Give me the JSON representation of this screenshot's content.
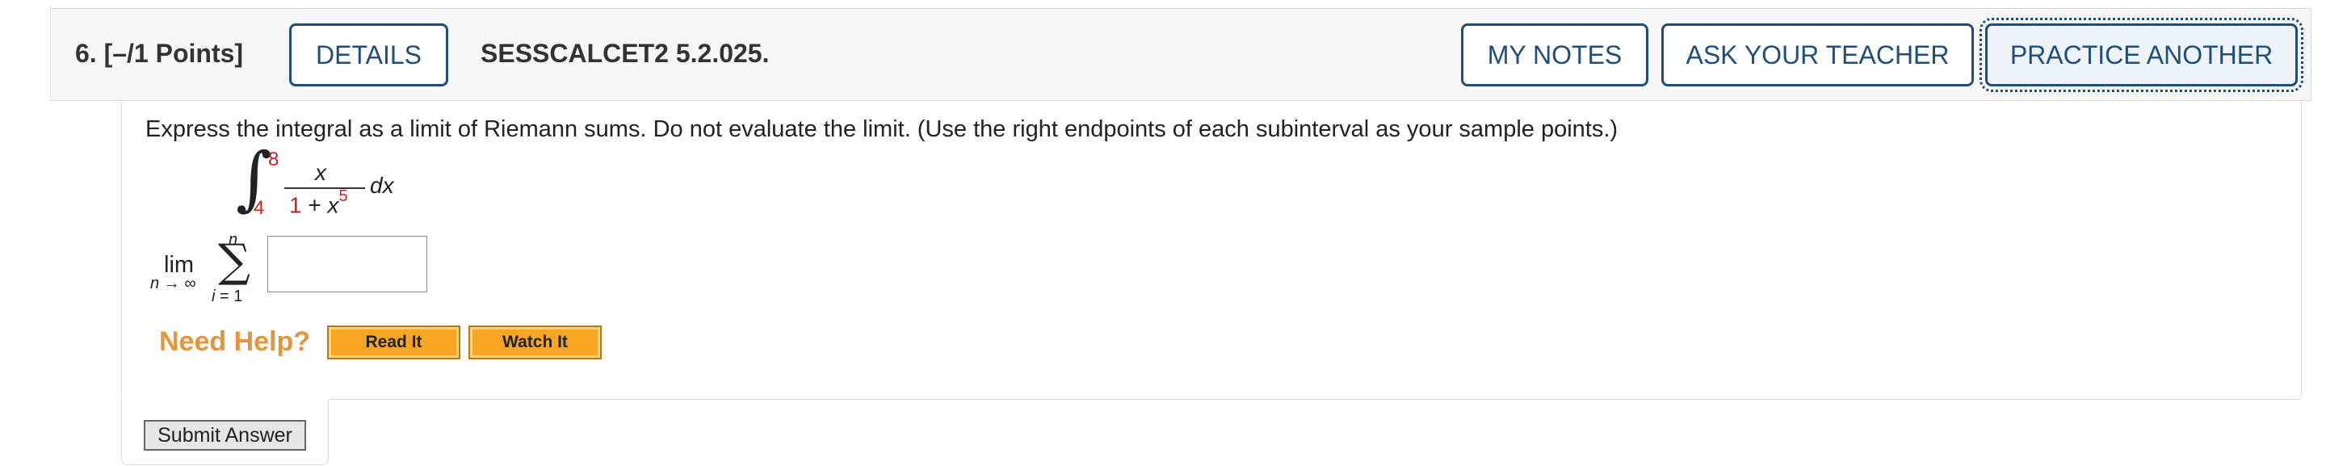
{
  "header": {
    "question_number": "6.",
    "points": "[–/1 Points]",
    "details_label": "DETAILS",
    "problem_code": "SESSCALCET2 5.2.025.",
    "my_notes_label": "MY NOTES",
    "ask_teacher_label": "ASK YOUR TEACHER",
    "practice_another_label": "PRACTICE ANOTHER"
  },
  "question": {
    "prompt": "Express the integral as a limit of Riemann sums. Do not evaluate the limit. (Use the right endpoints of each subinterval as your sample points.)",
    "integral": {
      "upper": "8",
      "lower": "4",
      "numerator": "x",
      "denominator_one": "1",
      "denominator_plus": " + ",
      "denominator_x": "x",
      "denominator_exp": "5",
      "differential": "dx"
    },
    "limit": {
      "word": "lim",
      "subscript": "n → ∞",
      "sum_top": "n",
      "sum_bottom_var": "i",
      "sum_bottom_rest": " = 1"
    },
    "answer_value": ""
  },
  "help": {
    "label": "Need Help?",
    "read_it": "Read It",
    "watch_it": "Watch It"
  },
  "submit_label": "Submit Answer"
}
